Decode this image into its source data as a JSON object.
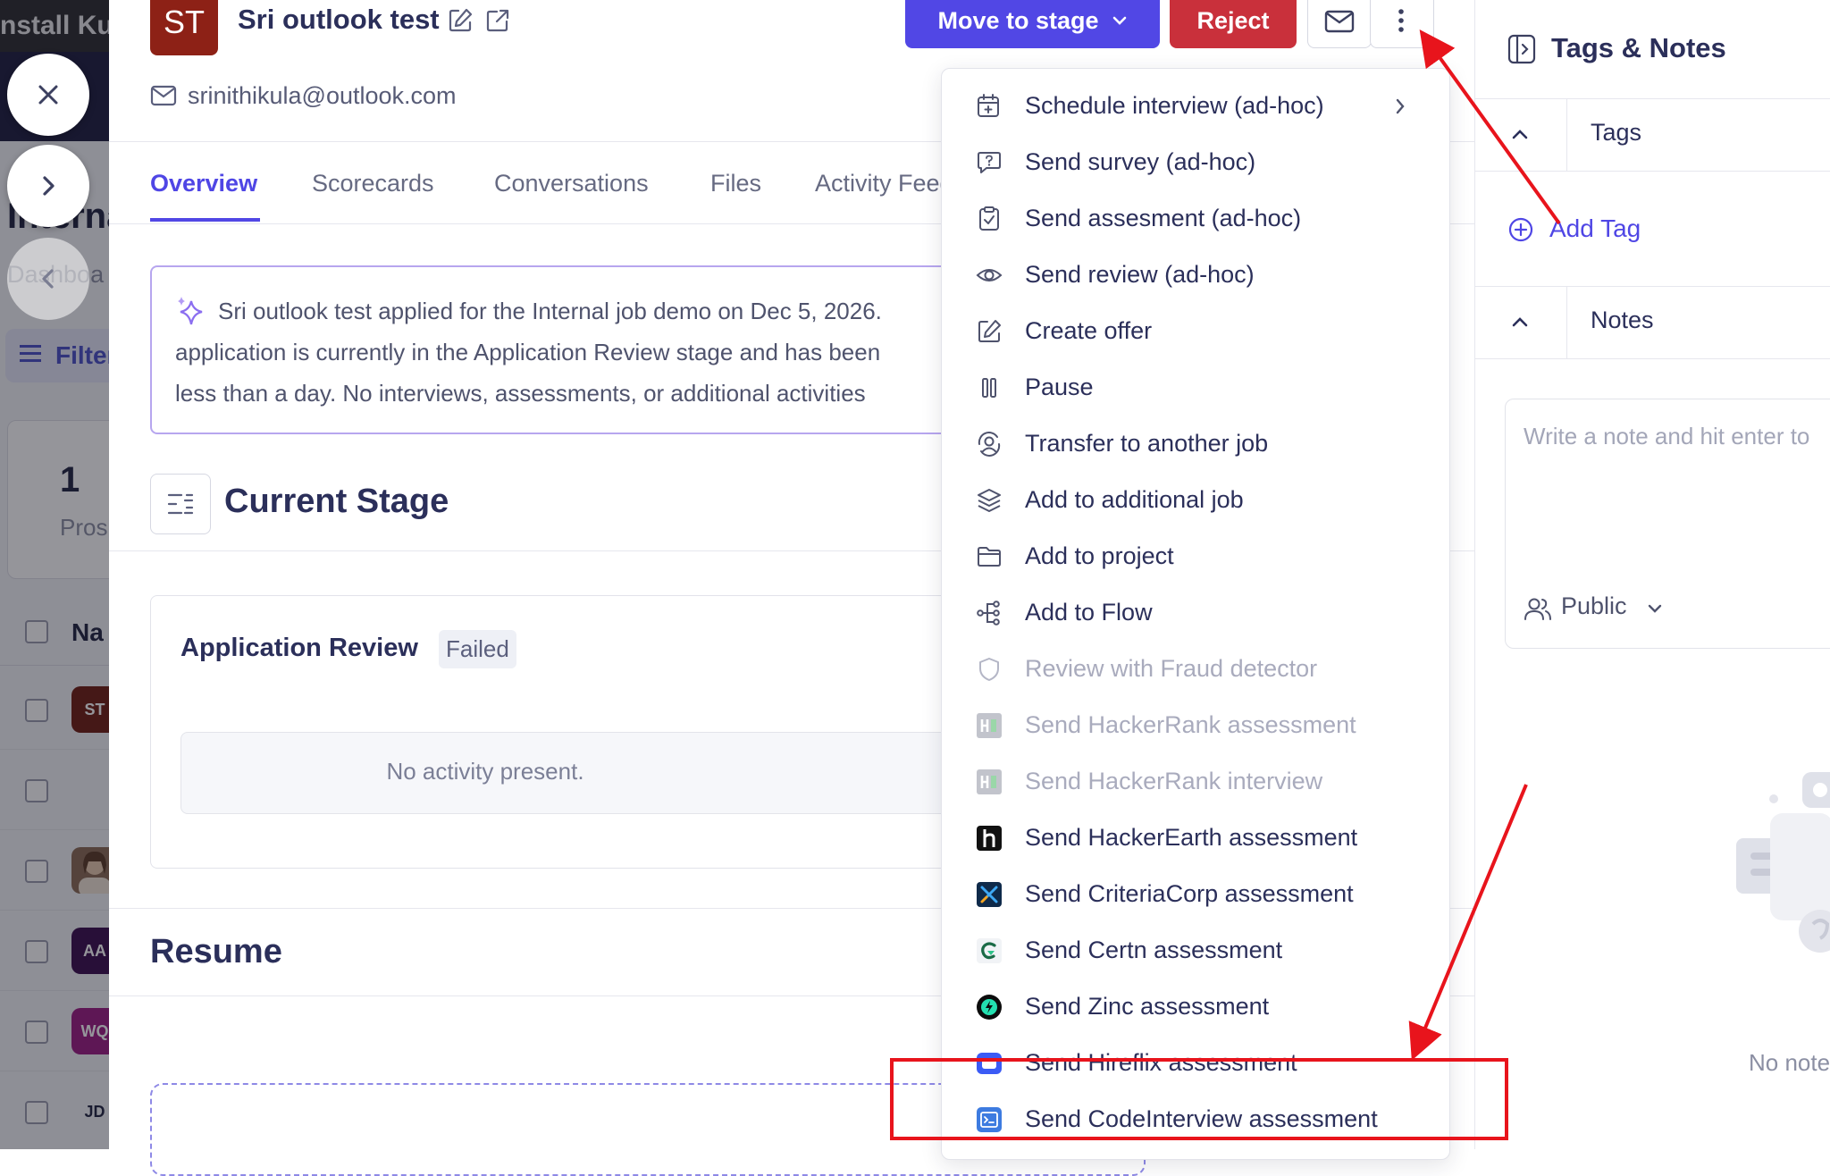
{
  "background": {
    "topbar_text": "nstall Kul",
    "page_title": "Interna",
    "breadcrumb": "Dashboa",
    "filter_label": "Filter",
    "stat_value": "1",
    "stat_label": "Pros",
    "table_header": "Na",
    "rows": [
      {
        "initials": "ST",
        "color": "#6e1c12"
      },
      {
        "initials": "",
        "color": ""
      },
      {
        "initials": "",
        "color": "#8a6b55"
      },
      {
        "initials": "AA",
        "color": "#3a0c4d"
      },
      {
        "initials": "WQ",
        "color": "#9b1a82"
      },
      {
        "initials": "JD",
        "color": ""
      }
    ]
  },
  "candidate": {
    "initials": "ST",
    "name": "Sri outlook test",
    "email": "srinithikula@outlook.com"
  },
  "header": {
    "move_to_stage": "Move to stage",
    "reject": "Reject"
  },
  "tabs": [
    {
      "label": "Overview",
      "active": true
    },
    {
      "label": "Scorecards",
      "active": false
    },
    {
      "label": "Conversations",
      "active": false
    },
    {
      "label": "Files",
      "active": false
    },
    {
      "label": "Activity Feed",
      "active": false
    }
  ],
  "summary": {
    "line1": "Sri outlook test applied for the Internal job demo on Dec 5, 2026.",
    "line2": "application is currently in the Application Review stage and has been",
    "line3": "less than a day. No interviews, assessments, or additional activities"
  },
  "current_stage": {
    "title": "Current Stage",
    "stage_name": "Application Review",
    "status": "Failed",
    "empty_text": "No activity present."
  },
  "resume": {
    "title": "Resume"
  },
  "menu": {
    "items": [
      {
        "label": "Schedule interview (ad-hoc)",
        "icon": "calendar-plus-icon",
        "disabled": false,
        "submenu": true
      },
      {
        "label": "Send survey (ad-hoc)",
        "icon": "chat-question-icon",
        "disabled": false
      },
      {
        "label": "Send assesment (ad-hoc)",
        "icon": "clipboard-check-icon",
        "disabled": false
      },
      {
        "label": "Send review (ad-hoc)",
        "icon": "eye-icon",
        "disabled": false
      },
      {
        "label": "Create offer",
        "icon": "edit-icon",
        "disabled": false
      },
      {
        "label": "Pause",
        "icon": "pause-icon",
        "disabled": false
      },
      {
        "label": "Transfer to another job",
        "icon": "user-transfer-icon",
        "disabled": false
      },
      {
        "label": "Add to additional job",
        "icon": "layers-icon",
        "disabled": false
      },
      {
        "label": "Add to project",
        "icon": "folder-icon",
        "disabled": false
      },
      {
        "label": "Add to Flow",
        "icon": "flow-icon",
        "disabled": false
      },
      {
        "label": "Review with Fraud detector",
        "icon": "shield-icon",
        "disabled": true
      },
      {
        "label": "Send HackerRank assessment",
        "icon": "hackerrank-logo-icon",
        "disabled": true
      },
      {
        "label": "Send HackerRank interview",
        "icon": "hackerrank-logo-icon",
        "disabled": true
      },
      {
        "label": "Send HackerEarth assessment",
        "icon": "hackerearth-logo-icon",
        "disabled": false
      },
      {
        "label": "Send CriteriaCorp assessment",
        "icon": "criteriacorp-logo-icon",
        "disabled": false
      },
      {
        "label": "Send Certn assessment",
        "icon": "certn-logo-icon",
        "disabled": false
      },
      {
        "label": "Send Zinc assessment",
        "icon": "zinc-logo-icon",
        "disabled": false
      },
      {
        "label": "Send Hireflix assessment",
        "icon": "hireflix-logo-icon",
        "disabled": false
      },
      {
        "label": "Send CodeInterview assessment",
        "icon": "codeinterview-logo-icon",
        "disabled": false
      }
    ]
  },
  "right_panel": {
    "title": "Tags & Notes",
    "tags_label": "Tags",
    "add_tag": "Add Tag",
    "notes_label": "Notes",
    "note_placeholder": "Write a note and hit enter to",
    "visibility": "Public",
    "empty_text": "No note"
  },
  "colors": {
    "primary": "#5147e5",
    "danger": "#c9303b",
    "annotation_red": "#e8141c"
  }
}
